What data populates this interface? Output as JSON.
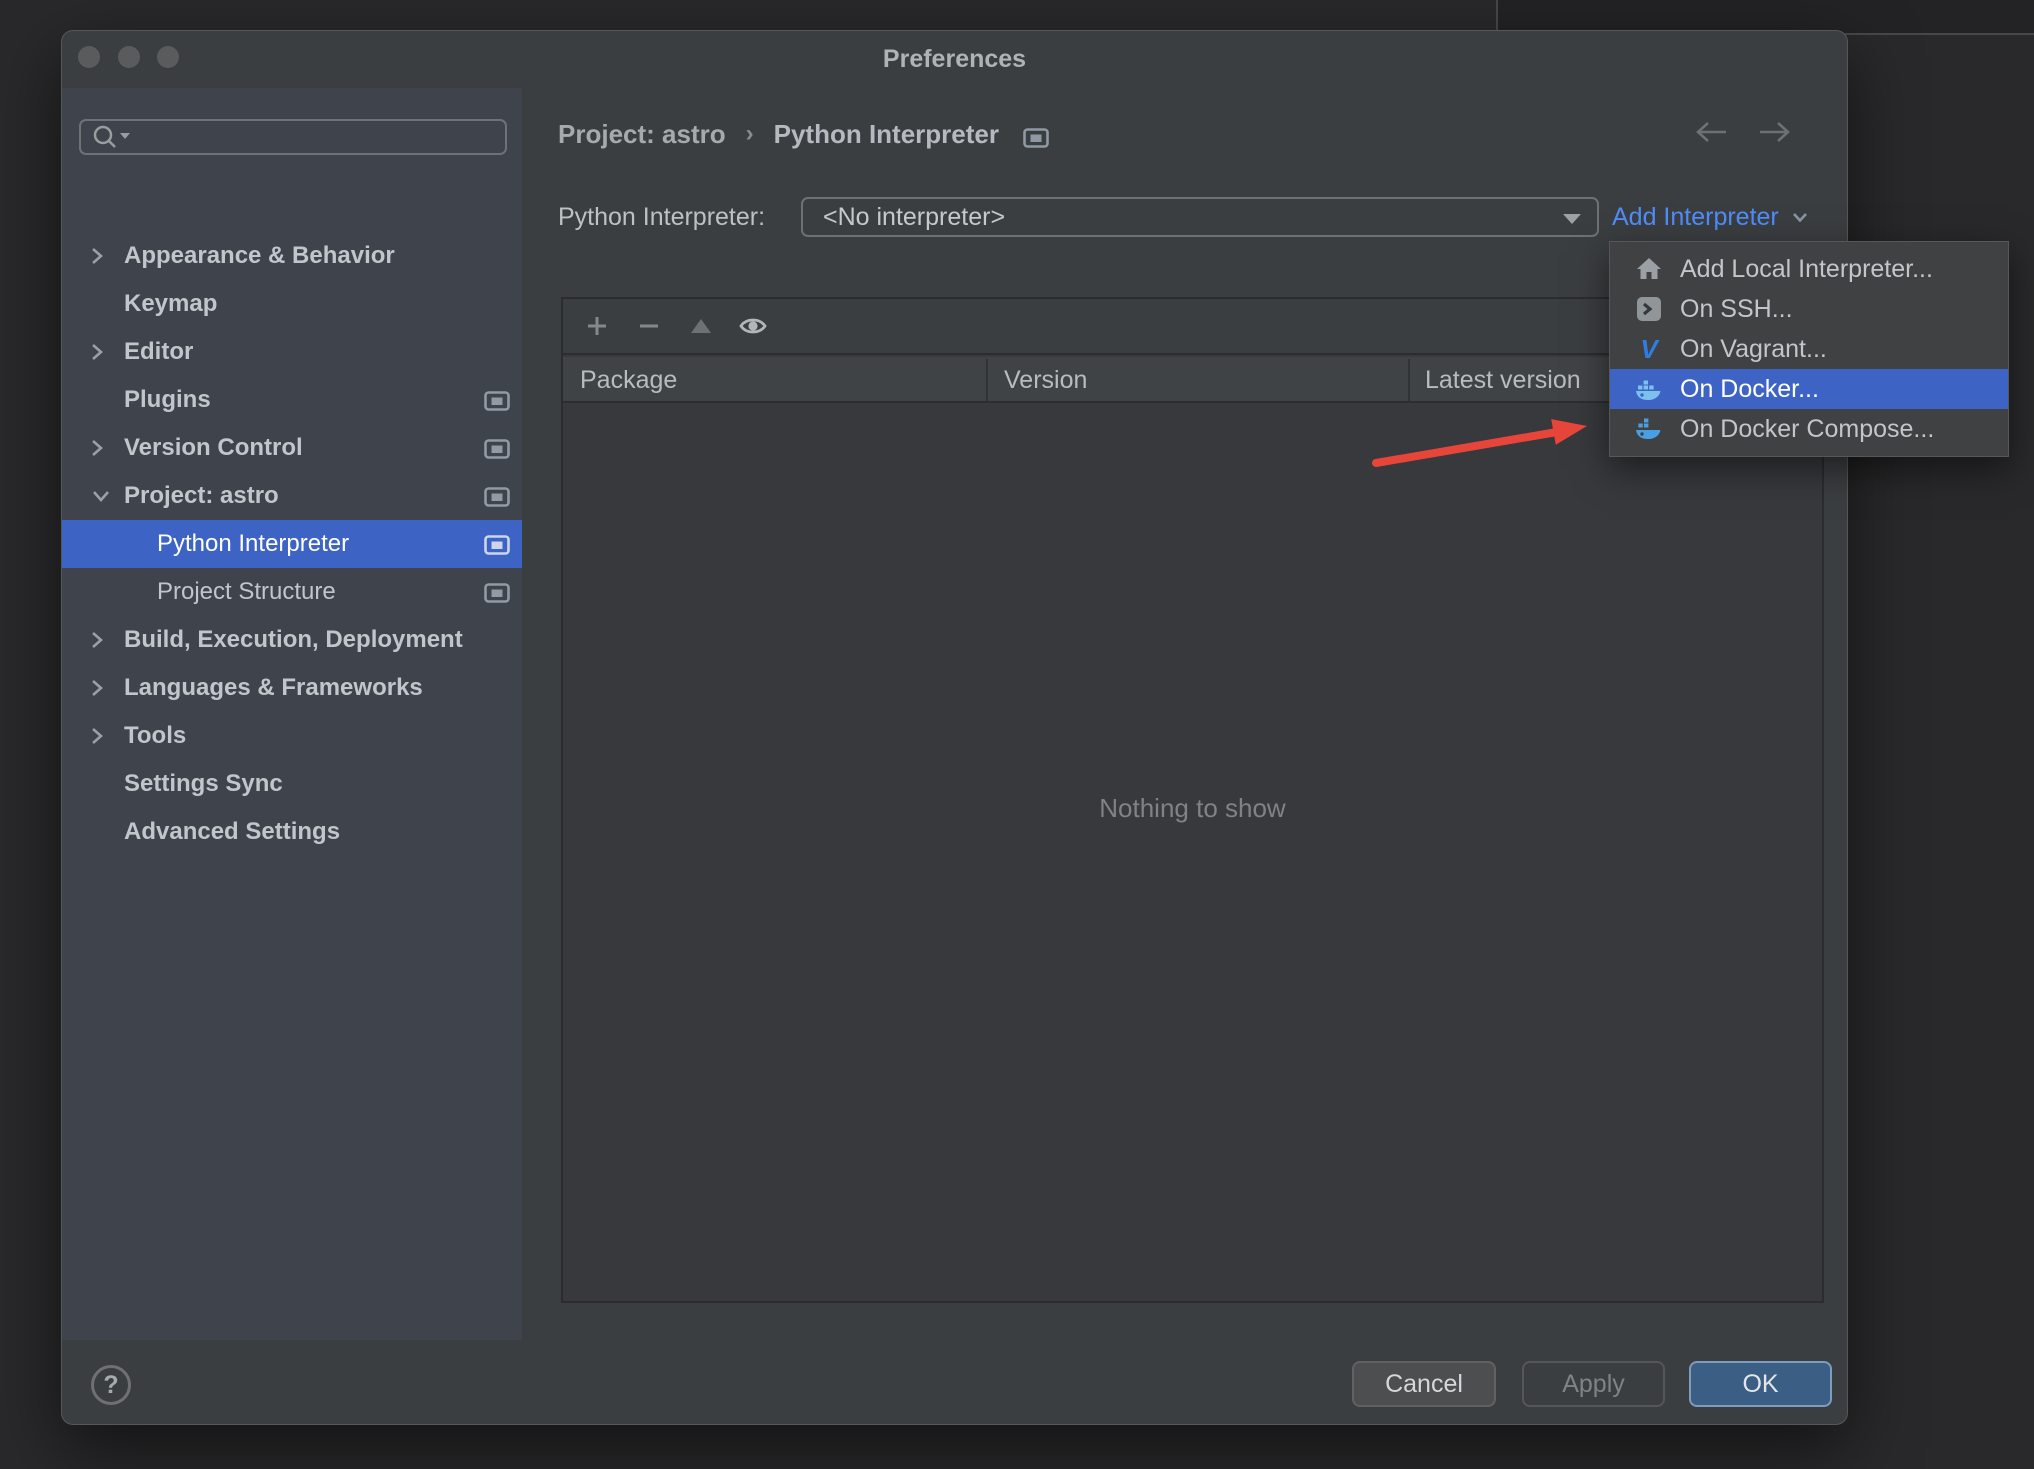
{
  "window": {
    "title": "Preferences"
  },
  "sidebar": {
    "items": [
      {
        "label": "Appearance & Behavior"
      },
      {
        "label": "Keymap"
      },
      {
        "label": "Editor"
      },
      {
        "label": "Plugins"
      },
      {
        "label": "Version Control"
      },
      {
        "label": "Project: astro"
      },
      {
        "label": "Python Interpreter",
        "selected": true
      },
      {
        "label": "Project Structure"
      },
      {
        "label": "Build, Execution, Deployment"
      },
      {
        "label": "Languages & Frameworks"
      },
      {
        "label": "Tools"
      },
      {
        "label": "Settings Sync"
      },
      {
        "label": "Advanced Settings"
      }
    ]
  },
  "breadcrumb": {
    "project": "Project: astro",
    "separator": "›",
    "page": "Python Interpreter"
  },
  "interpreter": {
    "label": "Python Interpreter:",
    "value": "<No interpreter>",
    "add_label": "Add Interpreter"
  },
  "menu": {
    "items": [
      {
        "label": "Add Local Interpreter...",
        "icon": "home"
      },
      {
        "label": "On SSH...",
        "icon": "ssh-terminal"
      },
      {
        "label": "On Vagrant...",
        "icon": "vagrant",
        "icon_letter": "V"
      },
      {
        "label": "On Docker...",
        "icon": "docker",
        "selected": true
      },
      {
        "label": "On Docker Compose...",
        "icon": "docker-compose"
      }
    ]
  },
  "table": {
    "columns": [
      "Package",
      "Version",
      "Latest version"
    ],
    "empty_text": "Nothing to show"
  },
  "footer": {
    "help_label": "?",
    "cancel_label": "Cancel",
    "apply_label": "Apply",
    "ok_label": "OK"
  },
  "colors": {
    "selection_blue": "#3d64c4",
    "link_blue": "#4f8df8",
    "ok_button": "#3a5e84",
    "sidebar_bg": "#3e434c",
    "dialog_bg": "#3b3e40",
    "arrow_red": "#e8453a"
  }
}
